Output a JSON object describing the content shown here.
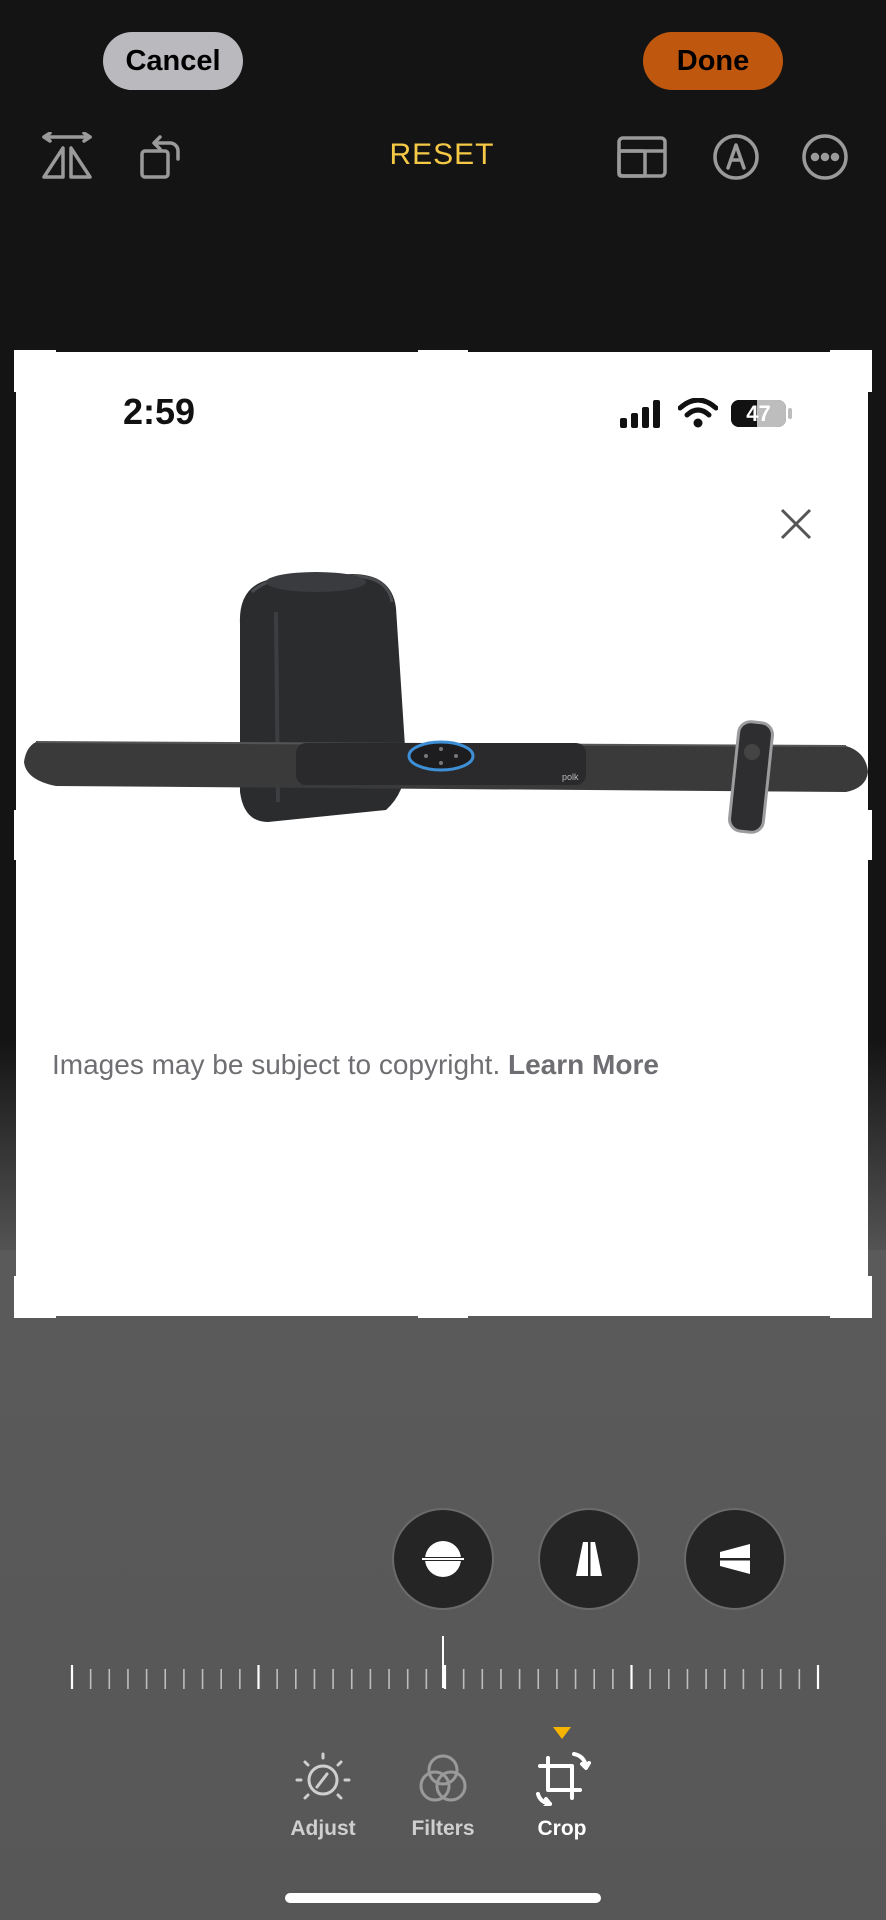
{
  "topbar": {
    "cancel_label": "Cancel",
    "done_label": "Done",
    "reset_label": "RESET"
  },
  "icons": {
    "flip": "flip-horizontal-icon",
    "rotate": "rotate-icon",
    "aspect": "aspect-ratio-icon",
    "markup": "markup-pen-icon",
    "more": "more-ellipsis-icon"
  },
  "photo": {
    "status_time": "2:59",
    "battery_level": "47",
    "battery_fraction": 0.47,
    "caption_text": "Images may be subject to copyright.",
    "caption_link": "Learn More",
    "brand_mark": "polk"
  },
  "perspective": {
    "buttons": [
      "straighten",
      "vertical",
      "horizontal"
    ]
  },
  "tabs": [
    {
      "label": "Adjust",
      "active": false
    },
    {
      "label": "Filters",
      "active": false
    },
    {
      "label": "Crop",
      "active": true
    }
  ],
  "colors": {
    "accent_reset": "#f5c946",
    "done_bg": "#c0570e",
    "cancel_bg": "#b9b9be",
    "tab_indicator": "#f4b400"
  }
}
